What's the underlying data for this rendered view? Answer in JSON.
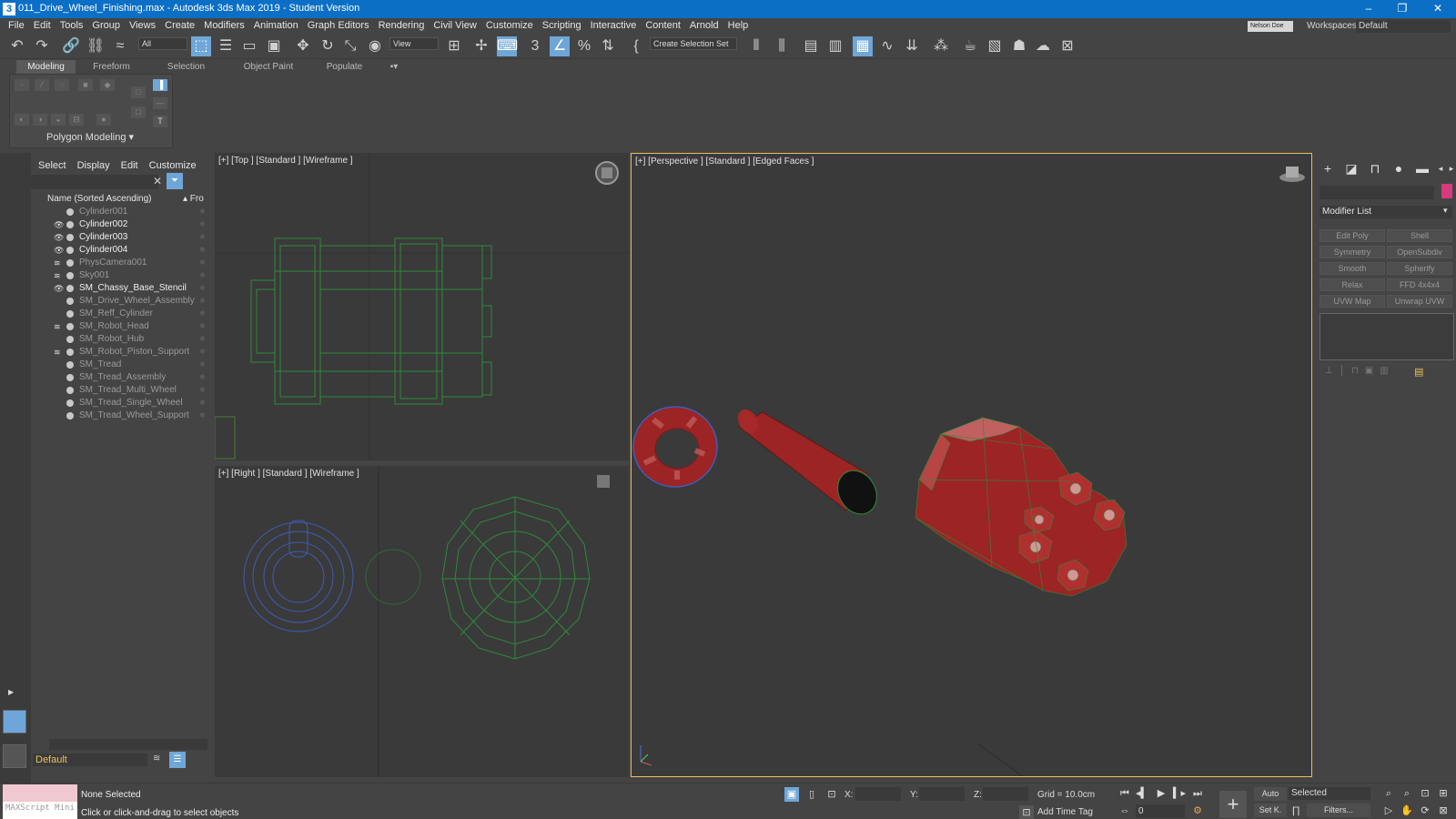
{
  "titlebar": {
    "app_icon": "3",
    "title": "011_Drive_Wheel_Finishing.max - Autodesk 3ds Max 2019 - Student Version",
    "minimize": "–",
    "restore": "❐",
    "close": "✕"
  },
  "menu": {
    "items": [
      "File",
      "Edit",
      "Tools",
      "Group",
      "Views",
      "Create",
      "Modifiers",
      "Animation",
      "Graph Editors",
      "Rendering",
      "Civil View",
      "Customize",
      "Scripting",
      "Interactive",
      "Content",
      "Arnold",
      "Help"
    ],
    "user": "Nelson Doe",
    "workspaces_label": "Workspaces:",
    "workspace_value": "Default"
  },
  "toolbar": {
    "selection_filter": "All",
    "reference_coord": "View",
    "selection_set": "Create Selection Set",
    "icons": [
      "undo-icon",
      "redo-icon",
      "link-icon",
      "unlink-icon",
      "bind-space-warp-icon",
      "select-object-icon",
      "select-by-name-icon",
      "rectangular-selection-icon",
      "window-crossing-icon",
      "select-move-icon",
      "select-rotate-icon",
      "select-scale-icon",
      "select-place-icon",
      "use-pivot-icon",
      "select-manipulate-icon",
      "keyboard-shortcut-icon",
      "snaps-toggle-icon",
      "angle-snap-icon",
      "percent-snap-icon",
      "spinner-snap-icon",
      "edit-named-sets-icon",
      "mirror-icon",
      "align-icon",
      "scene-explorer-icon",
      "layer-explorer-icon",
      "ribbon-toggle-icon",
      "curve-editor-icon",
      "schematic-view-icon",
      "material-editor-icon",
      "render-setup-icon",
      "rendered-frame-icon",
      "render-production-icon",
      "render-cloud-icon",
      "a360-gallery-icon"
    ]
  },
  "ribbon": {
    "tabs": [
      "Modeling",
      "Freeform",
      "Selection",
      "Object Paint",
      "Populate"
    ],
    "active_tab": "Modeling",
    "panel_label": "Polygon Modeling ▾"
  },
  "scene_explorer": {
    "menu": [
      "Select",
      "Display",
      "Edit",
      "Customize"
    ],
    "clear_icon": "✕",
    "header_name": "Name (Sorted Ascending)",
    "header_frozen": "▴ Fro",
    "objects": [
      {
        "name": "Cylinder001",
        "vis": "",
        "bright": false
      },
      {
        "name": "Cylinder002",
        "vis": "👁",
        "bright": true
      },
      {
        "name": "Cylinder003",
        "vis": "👁",
        "bright": true
      },
      {
        "name": "Cylinder004",
        "vis": "👁",
        "bright": true
      },
      {
        "name": "PhysCamera001",
        "vis": "≋",
        "bright": false
      },
      {
        "name": "Sky001",
        "vis": "≋",
        "bright": false
      },
      {
        "name": "SM_Chassy_Base_Stencil",
        "vis": "👁",
        "bright": true
      },
      {
        "name": "SM_Drive_Wheel_Assembly",
        "vis": "",
        "bright": false
      },
      {
        "name": "SM_Reff_Cylinder",
        "vis": "",
        "bright": false
      },
      {
        "name": "SM_Robot_Head",
        "vis": "≋",
        "bright": false
      },
      {
        "name": "SM_Robot_Hub",
        "vis": "",
        "bright": false
      },
      {
        "name": "SM_Robot_Piston_Support",
        "vis": "≋",
        "bright": false
      },
      {
        "name": "SM_Tread",
        "vis": "",
        "bright": false
      },
      {
        "name": "SM_Tread_Assembly",
        "vis": "",
        "bright": false
      },
      {
        "name": "SM_Tread_Multi_Wheel",
        "vis": "",
        "bright": false
      },
      {
        "name": "SM_Tread_Single_Wheel",
        "vis": "",
        "bright": false
      },
      {
        "name": "SM_Tread_Wheel_Support",
        "vis": "",
        "bright": false
      }
    ],
    "layer": "Default"
  },
  "viewports": {
    "top": "[+] [Top ] [Standard ] [Wireframe ]",
    "right": "[+] [Right ] [Standard ] [Wireframe ]",
    "perspective": "[+] [Perspective ] [Standard ] [Edged Faces ]"
  },
  "command_panel": {
    "modifier_list": "Modifier List",
    "modifier_buttons": [
      "Edit Poly",
      "Shell",
      "Symmetry",
      "OpenSubdiv",
      "Smooth",
      "Spherify",
      "Relax",
      "FFD 4x4x4",
      "UVW Map",
      "Unwrap UVW"
    ]
  },
  "status": {
    "maxscript": "MAXScript Mini",
    "selection": "None Selected",
    "prompt": "Click or click-and-drag to select objects",
    "x_label": "X:",
    "y_label": "Y:",
    "z_label": "Z:",
    "grid": "Grid = 10.0cm",
    "add_time_tag": "Add Time Tag",
    "auto_key": "Auto",
    "set_key": "Set K.",
    "key_mode": "Selected",
    "filters": "Filters...",
    "frame": "0"
  },
  "colors": {
    "title_blue": "#0b6fc6",
    "active_blue": "#6fa6d8",
    "model_red": "#9c2424",
    "wire_green": "#2e8a3a",
    "wire_blue": "#3d5db8",
    "layer_yellow": "#e8c15a"
  }
}
